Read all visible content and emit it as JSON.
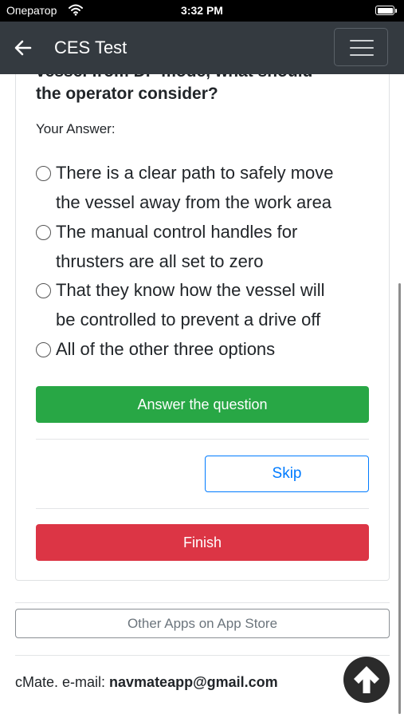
{
  "status_bar": {
    "carrier": "Оператор",
    "time": "3:32 PM"
  },
  "navbar": {
    "title": "CES Test"
  },
  "question": {
    "text_partial": "vessel from DP mode, what should",
    "text_last": "the operator consider?"
  },
  "answer_label": "Your Answer:",
  "options": [
    {
      "line1": "There is a clear path to safely move",
      "line2": "the vessel away from the work area"
    },
    {
      "line1": "The manual control handles for",
      "line2": "thrusters are all set to zero"
    },
    {
      "line1": "That they know how the vessel will",
      "line2": "be controlled to prevent a drive off"
    },
    {
      "line1": "All of the other three options",
      "line2": ""
    }
  ],
  "buttons": {
    "answer": "Answer the question",
    "skip": "Skip",
    "finish": "Finish",
    "other_apps": "Other Apps on App Store"
  },
  "footer": {
    "prefix": "cMate. e-mail: ",
    "email": "navmateapp@gmail.com"
  },
  "colors": {
    "navbar_bg": "#343a40",
    "answer_btn": "#28a745",
    "finish_btn": "#dc3545",
    "skip_btn": "#007bff"
  },
  "icons": {
    "back": "arrow-left-icon",
    "menu": "hamburger-menu-icon",
    "wifi": "wifi-icon",
    "battery": "battery-icon",
    "scroll_top": "arrow-up-circle-icon"
  }
}
